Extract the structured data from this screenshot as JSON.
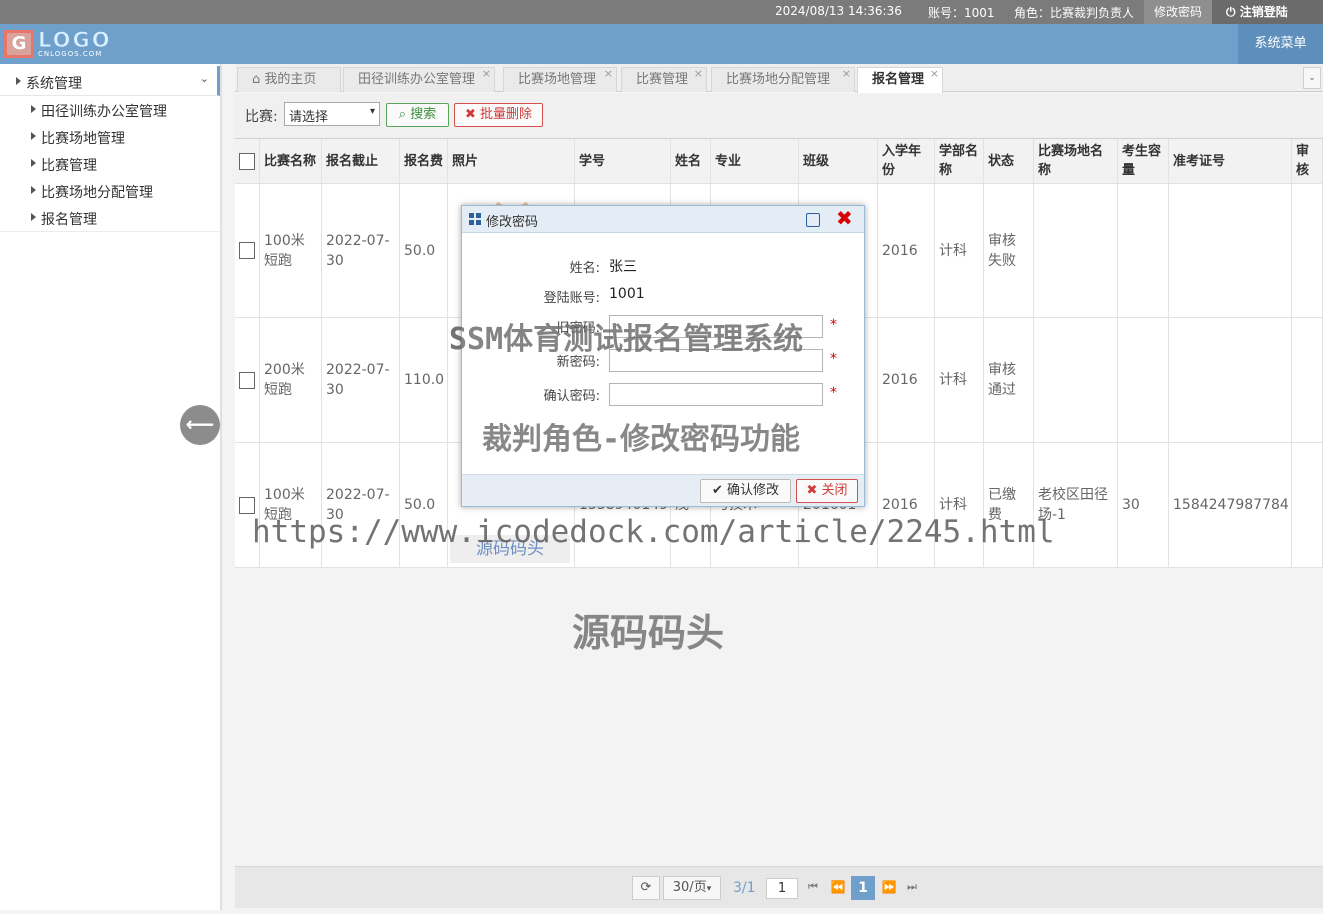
{
  "topbar": {
    "datetime": "2024/08/13 14:36:36",
    "account": "账号：1001",
    "role": "角色：比赛裁判负责人",
    "change_password": "修改密码",
    "logout": "注销登陆",
    "logout_icon": "power-icon"
  },
  "header": {
    "logo_letter": "G",
    "logo_text": "LOGO",
    "logo_sub": "CNLOGOS.COM",
    "system_menu": "系统菜单"
  },
  "sidebar": {
    "group": "系统管理",
    "items": [
      {
        "label": "田径训练办公室管理"
      },
      {
        "label": "比赛场地管理"
      },
      {
        "label": "比赛管理"
      },
      {
        "label": "比赛场地分配管理"
      },
      {
        "label": "报名管理"
      }
    ]
  },
  "tabs": [
    {
      "label": "我的主页",
      "icon": "home-icon"
    },
    {
      "label": "田径训练办公室管理"
    },
    {
      "label": "比赛场地管理"
    },
    {
      "label": "比赛管理"
    },
    {
      "label": "比赛场地分配管理"
    },
    {
      "label": "报名管理",
      "active": true
    }
  ],
  "toolbar": {
    "filter_label": "比赛:",
    "select_value": "请选择",
    "search_label": "搜索",
    "batch_delete_label": "批量删除"
  },
  "table": {
    "columns": [
      "比赛名称",
      "报名截止",
      "报名费",
      "照片",
      "学号",
      "姓名",
      "专业",
      "班级",
      "入学年份",
      "学部名称",
      "状态",
      "比赛场地名称",
      "考生容量",
      "准考证号",
      "审核"
    ],
    "rows": [
      [
        "100米短跑",
        "2022-07-30",
        "50.0",
        "",
        "",
        "",
        "",
        "",
        "2016",
        "计科",
        "审核失败",
        "",
        "",
        "",
        ""
      ],
      [
        "200米短跑",
        "2022-07-30",
        "110.0",
        "",
        "",
        "",
        "",
        "",
        "2016",
        "计科",
        "审核通过",
        "",
        "",
        "",
        ""
      ],
      [
        "100米短跑",
        "2022-07-30",
        "50.0",
        "源码码头",
        "1358940149",
        "茂",
        "与技术",
        "201601",
        "2016",
        "计科",
        "已缴费",
        "老校区田径场-1",
        "30",
        "1584247987784",
        ""
      ]
    ]
  },
  "pager": {
    "refresh_icon": "refresh-icon",
    "page_size": "30/页",
    "page_info": "3/1",
    "page_input": "1",
    "current_page": "1"
  },
  "dialog": {
    "title": "修改密码",
    "name_label": "姓名:",
    "name_value": "张三",
    "account_label": "登陆账号:",
    "account_value": "1001",
    "old_pwd_label": "旧密码:",
    "new_pwd_label": "新密码:",
    "confirm_pwd_label": "确认密码:",
    "required_mark": "*",
    "confirm_button": "确认修改",
    "close_button": "关闭"
  },
  "watermarks": {
    "title": "SSM体育测试报名管理系统",
    "subtitle": "裁判角色-修改密码功能",
    "url": "https://www.icodedock.com/article/2245.html",
    "brand": "源码码头"
  }
}
